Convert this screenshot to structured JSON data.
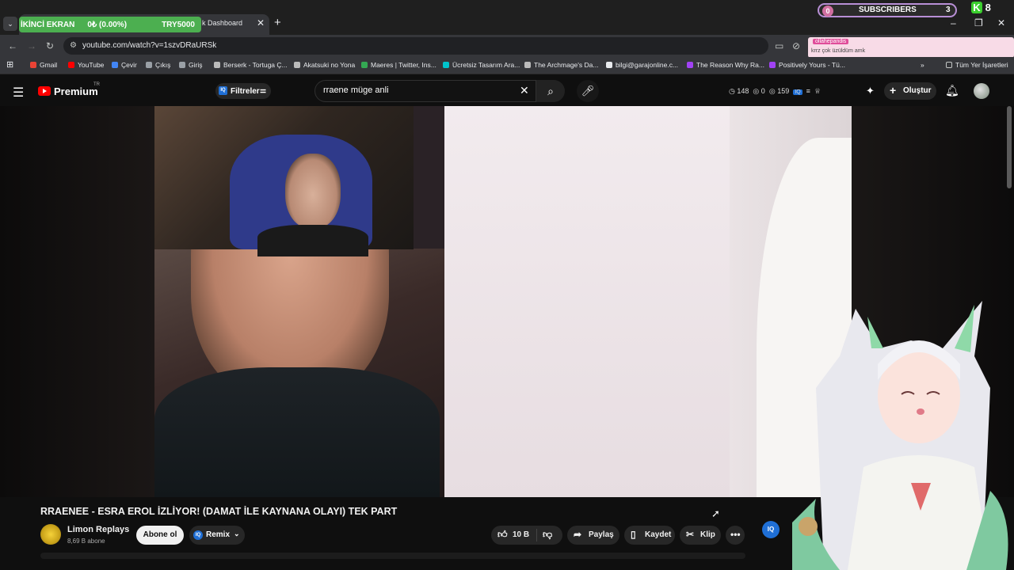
{
  "browser": {
    "tab_title": "Dashboard",
    "tab_partial_prefix": "k",
    "url": "youtube.com/watch?v=1szvDRaURSk",
    "overlay": {
      "label": "İKİNCİ EKRAN",
      "value": "0₺ (0.00%)",
      "target": "TRY5000"
    },
    "subscribers_widget": {
      "left_count": "0",
      "label": "SUBSCRIBERS",
      "right_count": "3"
    },
    "k_widget": {
      "letter": "K",
      "count": "8"
    },
    "chat_popup": {
      "user": "ollahepandis",
      "message": "krrz çok üzüldüm amk"
    },
    "bookmarks": [
      {
        "label": "Gmail",
        "color": "#ea4335"
      },
      {
        "label": "YouTube",
        "color": "#ff0000"
      },
      {
        "label": "Çevir",
        "color": "#4285f4"
      },
      {
        "label": "Çıkış",
        "color": "#9aa0a6"
      },
      {
        "label": "Giriş",
        "color": "#9aa0a6"
      },
      {
        "label": "Berserk - Tortuga Ç...",
        "color": "#bbbbbb"
      },
      {
        "label": "Akatsuki no Yona",
        "color": "#bbbbbb"
      },
      {
        "label": "Maeres | Twitter, Ins...",
        "color": "#34a853"
      },
      {
        "label": "Ücretsiz Tasarım Ara...",
        "color": "#00c4cc"
      },
      {
        "label": "The Archmage's Da...",
        "color": "#bbbbbb"
      },
      {
        "label": "bilgi@garajonline.c...",
        "color": "#e8eaed"
      },
      {
        "label": "The Reason Why Ra...",
        "color": "#a142f4"
      },
      {
        "label": "Positively Yours - Tü...",
        "color": "#a142f4"
      }
    ],
    "all_bookmarks": "Tüm Yer İşaretleri"
  },
  "youtube": {
    "brand": "Premium",
    "region": "TR",
    "filters_label": "Filtreler",
    "search_query": "rraene müge anli",
    "stats": {
      "a": "148",
      "b": "0",
      "c": "159"
    },
    "create_label": "Oluştur"
  },
  "video": {
    "title": "RRAENEE - ESRA EROL İZLİYOR! (DAMAT İLE KAYNANA OLAYI) TEK PART",
    "channel": "Limon Replays",
    "subscribers": "8,69 B abone",
    "subscribe_label": "Abone ol",
    "remix_label": "Remix",
    "likes": "10 B",
    "share_label": "Paylaş",
    "save_label": "Kaydet",
    "clip_label": "Klip"
  },
  "colors": {
    "accent": "#ff0000",
    "overlay_green": "#4caf50",
    "iq_blue": "#1f6fd6"
  }
}
